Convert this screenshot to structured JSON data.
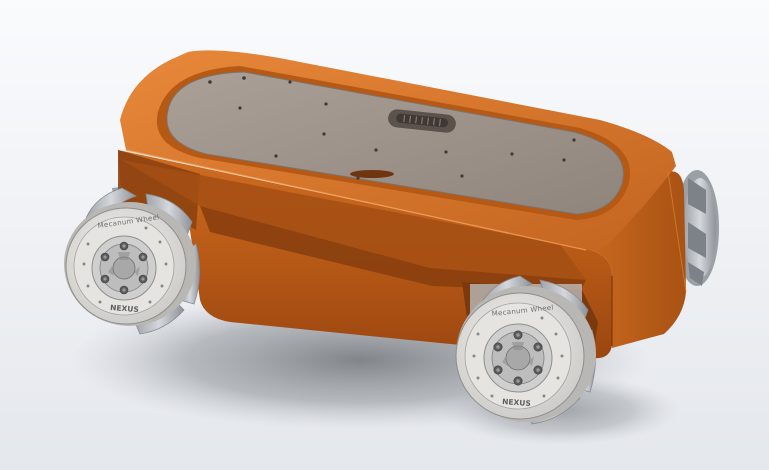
{
  "scene": {
    "subject": "mecanum-wheel robot chassis cad render",
    "colors": {
      "background_top": "#f7f8fb",
      "background_bottom": "#e7e9ee",
      "shadow": "#8e9196",
      "body_light": "#d97a2c",
      "body_mid": "#c0631b",
      "body_dark": "#8f4310",
      "lid_plate": "#9d9389",
      "wheel_tread": "#e9e7e4",
      "wheel_hub": "#c9c9c9",
      "roller": "#bfc2c6"
    }
  },
  "wheels": {
    "front_left": {
      "label_outer": "Mecanum Wheel",
      "label_brand": "NEXUS"
    },
    "front_right": {
      "label_outer": "Mecanum Wheel",
      "label_brand": "NEXUS"
    }
  }
}
